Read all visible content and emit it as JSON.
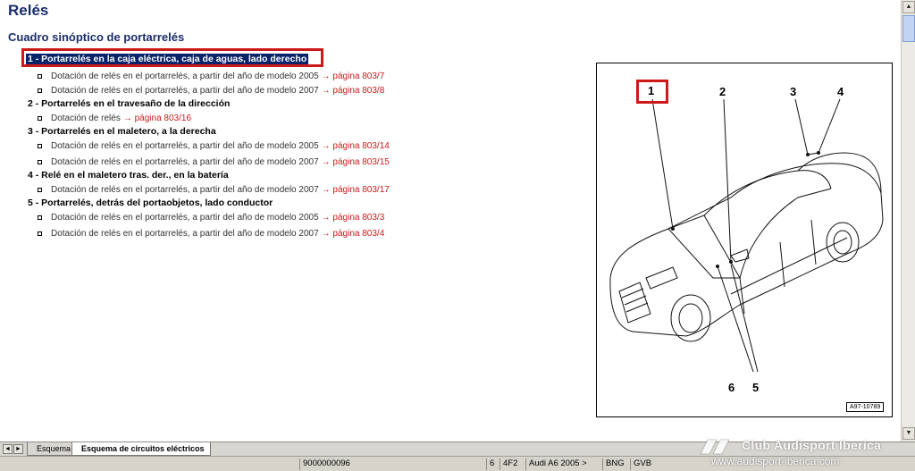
{
  "page": {
    "title": "Relés",
    "section_title": "Cuadro sinóptico de portarrelés"
  },
  "entries": [
    {
      "heading": "1 - Portarrelés en la caja eléctrica, caja de aguas, lado derecho",
      "items": [
        {
          "text": "Dotación de relés en el portarrelés, a partir del año de modelo 2005",
          "link": "→ página 803/7"
        },
        {
          "text": "Dotación de relés en el portarrelés, a partir del año de modelo 2007",
          "link": "→ página 803/8"
        }
      ]
    },
    {
      "heading": "2 - Portarrelés en el travesaño de la dirección",
      "items": [
        {
          "text": "Dotación de relés",
          "link": "→ página 803/16"
        }
      ]
    },
    {
      "heading": "3 - Portarrelés en el maletero, a la derecha",
      "items": [
        {
          "text": "Dotación de relés en el portarrelés, a partir del año de modelo 2005",
          "link": "→ página 803/14"
        },
        {
          "text": "Dotación de relés en el portarrelés, a partir del año de modelo 2007",
          "link": "→ página 803/15"
        }
      ]
    },
    {
      "heading": "4 - Relé en el maletero tras. der., en la batería",
      "items": [
        {
          "text": "Dotación de relés en el portarrelés, a partir del año de modelo 2007",
          "link": "→ página 803/17"
        }
      ]
    },
    {
      "heading": "5 - Portarrelés, detrás del portaobjetos, lado conductor",
      "items": [
        {
          "text": "Dotación de relés en el portarrelés, a partir del año de modelo 2005",
          "link": "→ página 803/3"
        },
        {
          "text": "Dotación de relés en el portarrelés, a partir del año de modelo 2007",
          "link": "→ página 803/4"
        }
      ]
    }
  ],
  "figure": {
    "callouts": [
      "1",
      "2",
      "3",
      "4",
      "5",
      "6"
    ],
    "id": "A97-10789"
  },
  "tabs": [
    {
      "label": "Esquema",
      "active": false
    },
    {
      "label": "Esquema de circuitos eléctricos",
      "active": true
    }
  ],
  "tab_nav": {
    "prev": "◄",
    "next": "►"
  },
  "status": {
    "doc_number": "9000000096",
    "field1": "6",
    "field2": "4F2",
    "field3": "Audi A6 2005 >",
    "field4": "BNG",
    "field5": "GVB"
  },
  "watermark": {
    "line1": "Club Audisport Iberica",
    "line2": "www.audisport-iberica.com"
  },
  "colors": {
    "heading_blue": "#1b2d6b",
    "link_red": "#cc1a1a",
    "selection_blue": "#0a246a"
  }
}
